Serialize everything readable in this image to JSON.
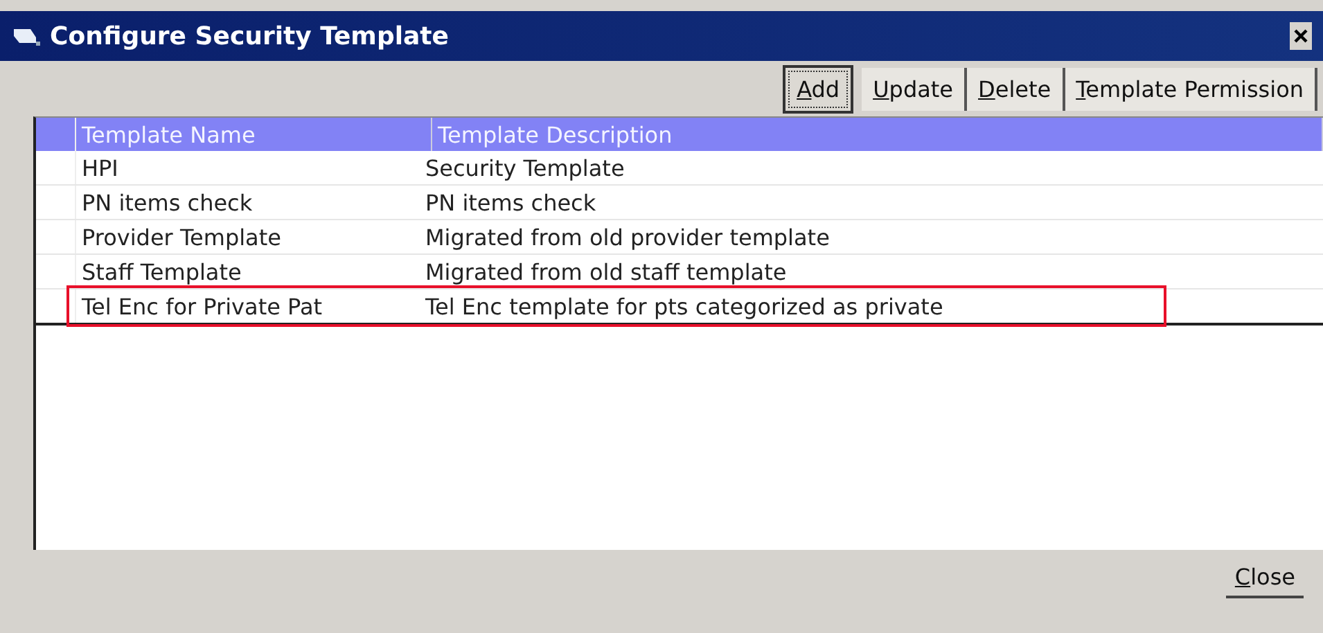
{
  "window": {
    "title": "Configure Security Template"
  },
  "toolbar": [
    {
      "access_key": "A",
      "rest": "dd",
      "focused": true
    },
    {
      "access_key": "U",
      "rest": "pdate",
      "focused": false
    },
    {
      "access_key": "D",
      "rest": "elete",
      "focused": false
    },
    {
      "access_key": "T",
      "rest": "emplate Permission",
      "focused": false
    }
  ],
  "table": {
    "columns": [
      "Template Name",
      "Template Description"
    ],
    "rows": [
      {
        "cells": [
          "HPI",
          "Security Template"
        ],
        "highlighted": false
      },
      {
        "cells": [
          "PN items check",
          "PN items check"
        ],
        "highlighted": false
      },
      {
        "cells": [
          "Provider Template",
          "Migrated from old provider template"
        ],
        "highlighted": false
      },
      {
        "cells": [
          "Staff Template",
          "Migrated from old staff template"
        ],
        "highlighted": false
      },
      {
        "cells": [
          "Tel Enc for Private Pat",
          "Tel Enc template for pts categorized as private"
        ],
        "highlighted": true
      }
    ]
  },
  "footer": [
    {
      "access_key": "C",
      "rest": "lose"
    }
  ]
}
